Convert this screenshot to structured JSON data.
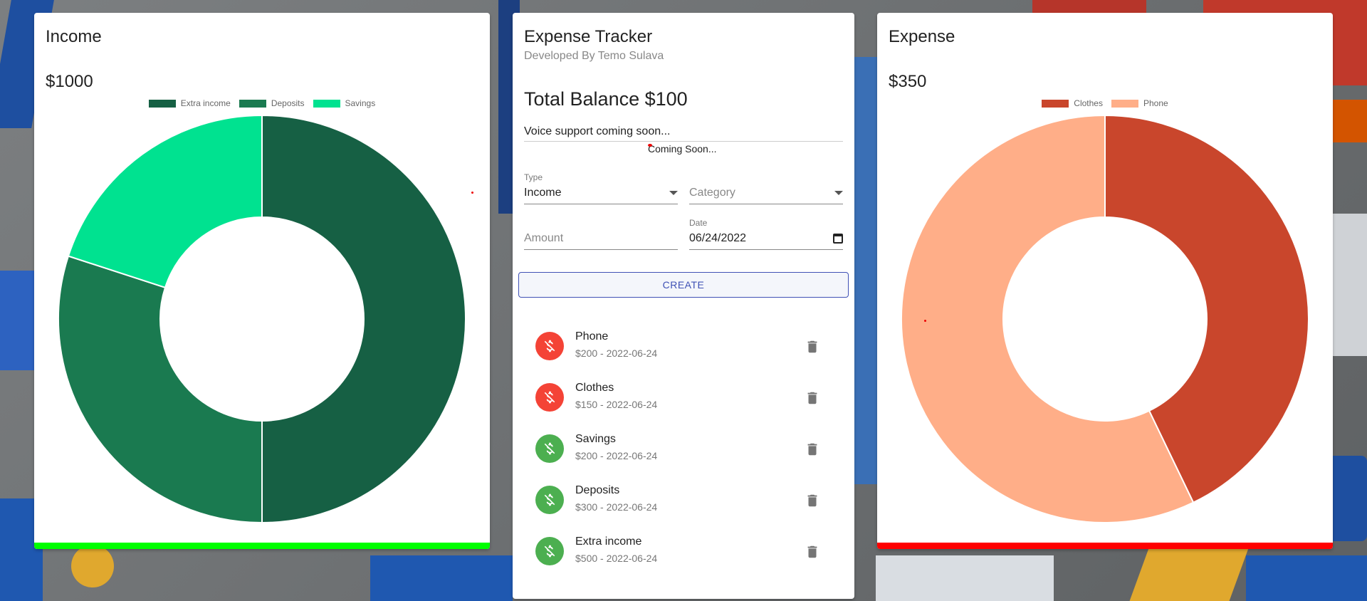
{
  "income": {
    "title": "Income",
    "amount": "$1000",
    "bar_color": "#00ff00"
  },
  "expense": {
    "title": "Expense",
    "amount": "$350",
    "bar_color": "#ff0000"
  },
  "tracker": {
    "title": "Expense Tracker",
    "subtitle": "Developed By Temo Sulava",
    "balance": "Total Balance $100",
    "voice_hint": "Voice support coming soon...",
    "coming_soon": "Coming Soon...",
    "type_label": "Type",
    "type_value": "Income",
    "category_placeholder": "Category",
    "amount_placeholder": "Amount",
    "date_label": "Date",
    "date_value": "06/24/2022",
    "create_label": "CREATE",
    "transactions": [
      {
        "name": "Phone",
        "meta": "$200 - 2022-06-24",
        "kind": "expense",
        "color": "#f44336"
      },
      {
        "name": "Clothes",
        "meta": "$150 - 2022-06-24",
        "kind": "expense",
        "color": "#f44336"
      },
      {
        "name": "Savings",
        "meta": "$200 - 2022-06-24",
        "kind": "income",
        "color": "#4caf50"
      },
      {
        "name": "Deposits",
        "meta": "$300 - 2022-06-24",
        "kind": "income",
        "color": "#4caf50"
      },
      {
        "name": "Extra income",
        "meta": "$500 - 2022-06-24",
        "kind": "income",
        "color": "#4caf50"
      }
    ]
  },
  "chart_data": [
    {
      "type": "pie",
      "categories": [
        "Extra income",
        "Deposits",
        "Savings"
      ],
      "values": [
        500,
        300,
        200
      ],
      "colors": [
        "#166044",
        "#1a7a50",
        "#00e290"
      ],
      "legend": "top"
    },
    {
      "type": "pie",
      "categories": [
        "Clothes",
        "Phone"
      ],
      "values": [
        150,
        200
      ],
      "colors": [
        "#c9462c",
        "#ffae88"
      ],
      "legend": "top"
    }
  ]
}
